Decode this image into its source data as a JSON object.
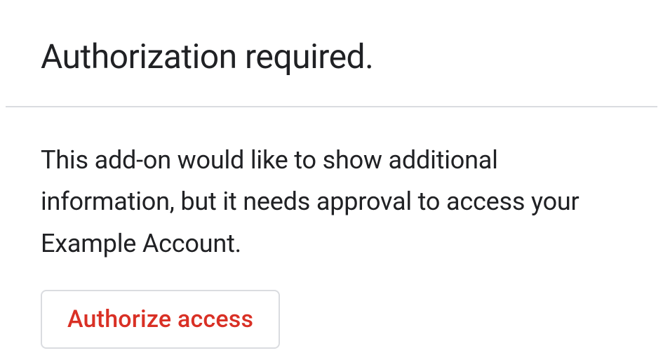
{
  "header": {
    "title": "Authorization required."
  },
  "content": {
    "description": "This add-on would like to show additional information, but it needs approval to access your Example Account.",
    "authorize_label": "Authorize access"
  }
}
